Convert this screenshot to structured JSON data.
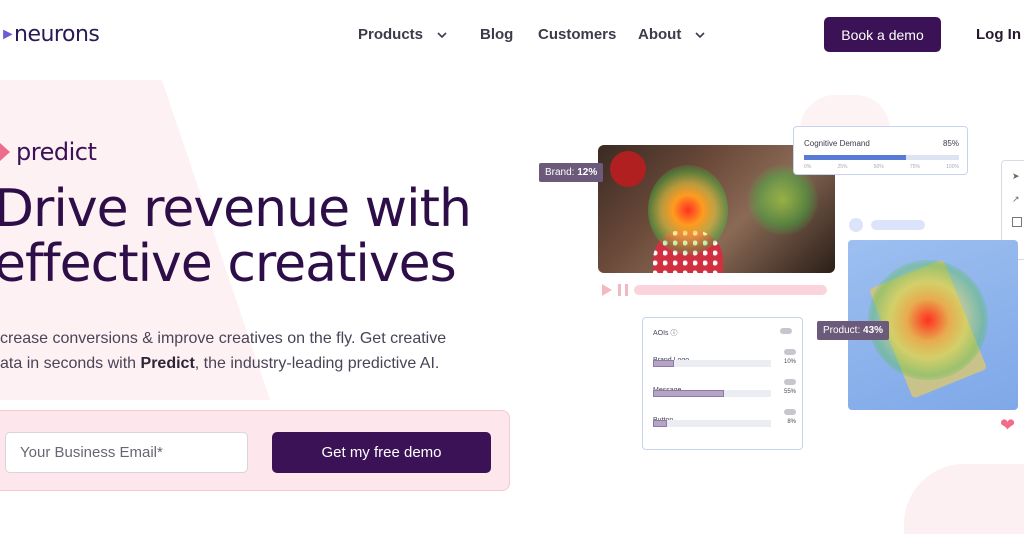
{
  "nav": {
    "logo_text": "neurons",
    "items": [
      {
        "label": "Products",
        "has_dropdown": true
      },
      {
        "label": "Blog",
        "has_dropdown": false
      },
      {
        "label": "Customers",
        "has_dropdown": false
      },
      {
        "label": "About",
        "has_dropdown": true
      }
    ],
    "book_demo_label": "Book a demo",
    "login_label": "Log In"
  },
  "hero": {
    "product_name": "predict",
    "headline_line1": "Drive revenue with",
    "headline_line2": "effective creatives",
    "sub_part1": "crease conversions & improve creatives on the fly. Get creative",
    "sub_part2": "ata in seconds with ",
    "sub_bold": "Predict",
    "sub_part3": ", the industry-leading predictive AI.",
    "email_placeholder": "Your Business Email*",
    "cta_label": "Get my free demo"
  },
  "visual": {
    "brand_tag_label": "Brand:",
    "brand_tag_value": "12%",
    "product_tag_label": "Product:",
    "product_tag_value": "43%",
    "cognitive": {
      "title": "Cognitive Demand",
      "value": "85%",
      "fill": 0.66,
      "ticks": [
        "0%",
        "25%",
        "50%",
        "75%",
        "100%"
      ]
    },
    "aoi": {
      "header": "AOIs ⓘ",
      "rows": [
        {
          "label": "Brand Logo",
          "pct": "10%",
          "fill": 0.18
        },
        {
          "label": "Message",
          "pct": "55%",
          "fill": 0.6
        },
        {
          "label": "Button",
          "pct": "8%",
          "fill": 0.12
        }
      ]
    },
    "colors": {
      "accent": "#3b1256",
      "pink": "#ec6c8b",
      "blue": "#5a7ad8"
    }
  }
}
